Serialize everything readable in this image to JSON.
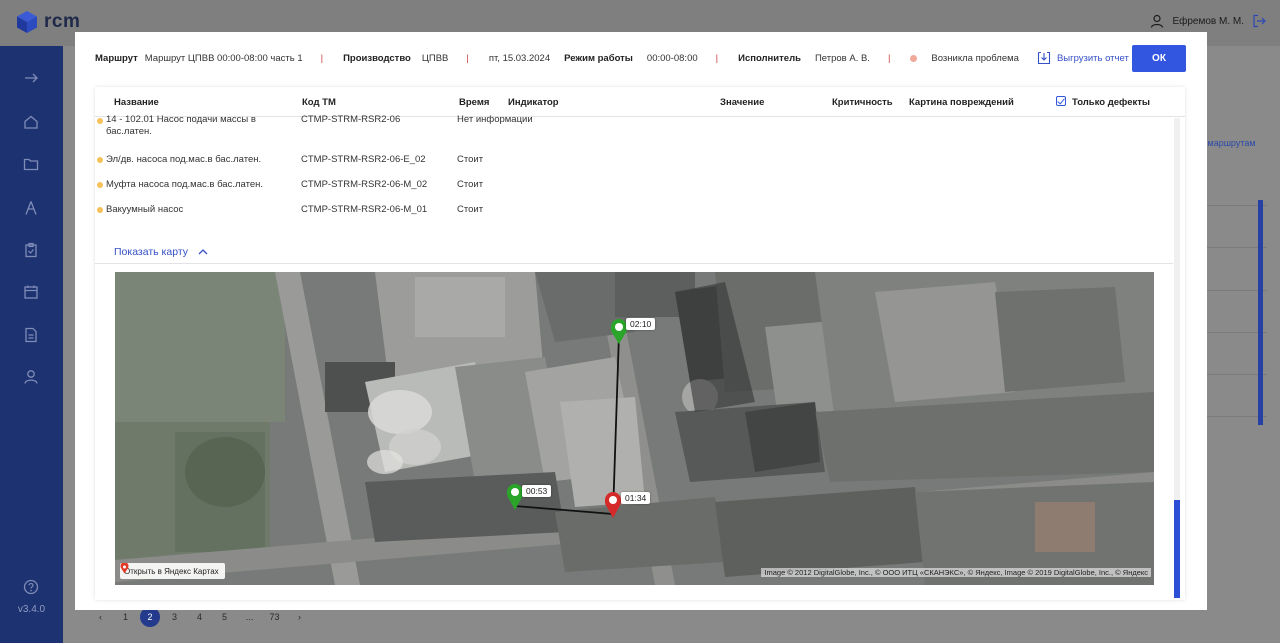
{
  "app": {
    "logo_text": "rcm",
    "version": "v3.4.0"
  },
  "user": {
    "name": "Ефремов М. М."
  },
  "background": {
    "link_text": "о маршрутам",
    "pagination": [
      "‹",
      "1",
      "2",
      "3",
      "4",
      "5",
      "...",
      "73",
      "›"
    ],
    "active_page": "2"
  },
  "header": {
    "route_label": "Маршрут",
    "route_value": "Маршрут ЦПВВ 00:00-08:00 часть 1",
    "production_label": "Производство",
    "production_value": "ЦПВВ",
    "date_value": "пт, 15.03.2024",
    "mode_label": "Режим работы",
    "mode_value": "00:00-08:00",
    "executor_label": "Исполнитель",
    "executor_value": "Петров А. В.",
    "status_text": "Возникла проблема",
    "export_label": "Выгрузить отчет",
    "ok_label": "ОК"
  },
  "table": {
    "columns": [
      "Название",
      "Код ТМ",
      "Время",
      "Индикатор",
      "Значение",
      "Критичность",
      "Картина повреждений"
    ],
    "only_defects_label": "Только дефекты",
    "rows": [
      {
        "name": "14 - 102.01 Насос подачи массы в бас.латен.",
        "code": "CTMP-STRM-RSR2-06",
        "time": "Нет информации"
      },
      {
        "name": "Эл/дв. насоса под.мас.в бас.латен.",
        "code": "CTMP-STRM-RSR2-06-E_02",
        "time": "Стоит"
      },
      {
        "name": "Муфта насоса под.мас.в бас.латен.",
        "code": "CTMP-STRM-RSR2-06-M_02",
        "time": "Стоит"
      },
      {
        "name": "Вакуумный насос",
        "code": "CTMP-STRM-RSR2-06-M_01",
        "time": "Стоит"
      }
    ]
  },
  "map": {
    "toggle_label": "Показать карту",
    "open_label": "Открыть в Яндекс Картах",
    "copyright": "Image © 2012 DigitalGlobe, Inc., © ООО ИТЦ «СКАНЭКС», © Яндекс, Image © 2019 DigitalGlobe, Inc., © Яндекс",
    "markers": [
      {
        "label": "02:10",
        "color": "#2aa52a"
      },
      {
        "label": "00:53",
        "color": "#2aa52a"
      },
      {
        "label": "01:34",
        "color": "#d42a2a"
      }
    ]
  },
  "colors": {
    "accent": "#3356e0",
    "sidebar": "#1d3270",
    "warning_dot": "#f5c15a",
    "problem_dot": "#f0a89a"
  }
}
